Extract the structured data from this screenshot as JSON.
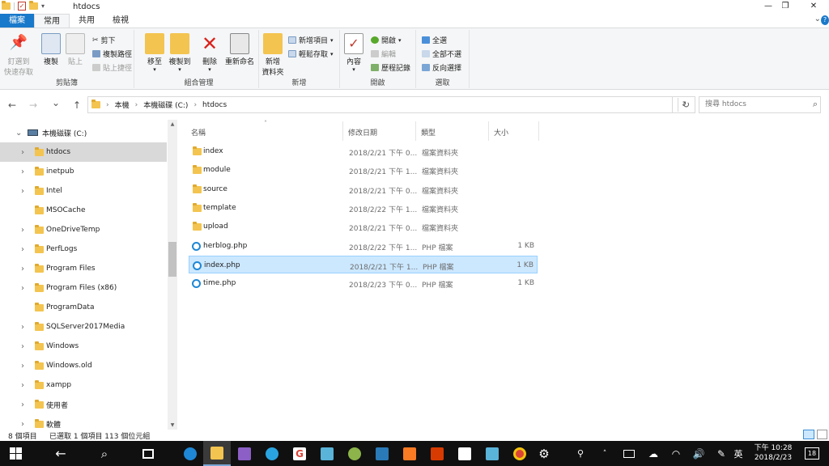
{
  "window": {
    "title": "htdocs",
    "controls": [
      "—",
      "❐",
      "✕"
    ]
  },
  "tabs": [
    {
      "label": "檔案"
    },
    {
      "label": "常用"
    },
    {
      "label": "共用"
    },
    {
      "label": "檢視"
    }
  ],
  "ribbon": {
    "clipboard": {
      "group_label": "剪貼簿",
      "pin_label_1": "釘選到",
      "pin_label_2": "快速存取",
      "copy": "複製",
      "paste": "貼上",
      "cut": "剪下",
      "copy_path": "複製路徑",
      "paste_shortcut": "貼上捷徑"
    },
    "organize": {
      "group_label": "組合管理",
      "move_to": "移至",
      "copy_to": "複製到",
      "delete": "刪除",
      "rename": "重新命名"
    },
    "new": {
      "group_label": "新增",
      "new_folder_1": "新增",
      "new_folder_2": "資料夾",
      "new_item": "新增項目",
      "easy_access": "輕鬆存取"
    },
    "open": {
      "group_label": "開啟",
      "properties": "內容",
      "open": "開啟",
      "edit": "編輯",
      "history": "歷程記錄"
    },
    "select": {
      "group_label": "選取",
      "select_all": "全選",
      "select_none": "全部不選",
      "invert": "反向選擇"
    }
  },
  "address": {
    "back": "←",
    "forward": "→",
    "recent": "⌄",
    "up": "↑",
    "crumbs": [
      "本機",
      "本機磁碟 (C:)",
      "htdocs"
    ],
    "search_placeholder": "搜尋 htdocs"
  },
  "nav_pane": {
    "root": "本機磁碟 (C:)",
    "items": [
      {
        "label": "htdocs",
        "selected": true
      },
      {
        "label": "inetpub"
      },
      {
        "label": "Intel"
      },
      {
        "label": "MSOCache"
      },
      {
        "label": "OneDriveTemp"
      },
      {
        "label": "PerfLogs"
      },
      {
        "label": "Program Files"
      },
      {
        "label": "Program Files (x86)"
      },
      {
        "label": "ProgramData"
      },
      {
        "label": "SQLServer2017Media"
      },
      {
        "label": "Windows"
      },
      {
        "label": "Windows.old"
      },
      {
        "label": "xampp"
      },
      {
        "label": "使用者"
      },
      {
        "label": "軟體"
      }
    ]
  },
  "columns": {
    "name": "名稱",
    "modified": "修改日期",
    "type": "類型",
    "size": "大小"
  },
  "files": [
    {
      "name": "index",
      "modified": "2018/2/21 下午 0...",
      "type": "檔案資料夾",
      "size": "",
      "kind": "folder"
    },
    {
      "name": "module",
      "modified": "2018/2/21 下午 1...",
      "type": "檔案資料夾",
      "size": "",
      "kind": "folder"
    },
    {
      "name": "source",
      "modified": "2018/2/21 下午 0...",
      "type": "檔案資料夾",
      "size": "",
      "kind": "folder"
    },
    {
      "name": "template",
      "modified": "2018/2/22 下午 1...",
      "type": "檔案資料夾",
      "size": "",
      "kind": "folder"
    },
    {
      "name": "upload",
      "modified": "2018/2/21 下午 0...",
      "type": "檔案資料夾",
      "size": "",
      "kind": "folder"
    },
    {
      "name": "herblog.php",
      "modified": "2018/2/22 下午 1...",
      "type": "PHP 檔案",
      "size": "1 KB",
      "kind": "php"
    },
    {
      "name": "index.php",
      "modified": "2018/2/21 下午 1...",
      "type": "PHP 檔案",
      "size": "1 KB",
      "kind": "php",
      "selected": true
    },
    {
      "name": "time.php",
      "modified": "2018/2/23 下午 0...",
      "type": "PHP 檔案",
      "size": "1 KB",
      "kind": "php"
    }
  ],
  "status": {
    "count": "8 個項目",
    "selection": "已選取 1 個項目  113 個位元組"
  },
  "taskbar": {
    "time": "下午 10:28",
    "date": "2018/2/23",
    "ime": "英",
    "notif": "18"
  },
  "colors": {
    "accent": "#1979ca",
    "selection": "#cce8ff",
    "folder": "#f3c44f",
    "taskbar": "#101010"
  }
}
